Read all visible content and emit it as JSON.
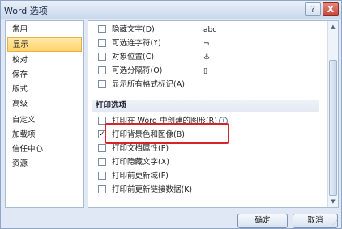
{
  "window": {
    "title": "Word 选项",
    "help": "?",
    "close": "X"
  },
  "sidebar": {
    "items": [
      {
        "label": "常用"
      },
      {
        "label": "显示"
      },
      {
        "label": "校对"
      },
      {
        "label": "保存"
      },
      {
        "label": "版式"
      },
      {
        "label": "高级"
      },
      {
        "label": "自定义"
      },
      {
        "label": "加载项"
      },
      {
        "label": "信任中心"
      },
      {
        "label": "资源"
      }
    ],
    "active": "显示"
  },
  "display_options": [
    {
      "label": "隐藏文字(D)",
      "checked": false,
      "symbol": "abc"
    },
    {
      "label": "可选连字符(Y)",
      "checked": false,
      "symbol": "¬"
    },
    {
      "label": "对象位置(C)",
      "checked": false,
      "symbol": "⚓"
    },
    {
      "label": "可选分隔符(O)",
      "checked": false,
      "symbol": "▯"
    },
    {
      "label": "显示所有格式标记(A)",
      "checked": false,
      "symbol": ""
    }
  ],
  "print_section_title": "打印选项",
  "print_options": [
    {
      "label": "打印在 Word 中创建的图形(R)",
      "checked": false,
      "info": "i"
    },
    {
      "label": "打印背景色和图像(B)",
      "checked": true
    },
    {
      "label": "打印文档属性(P)",
      "checked": false
    },
    {
      "label": "打印隐藏文字(X)",
      "checked": false
    },
    {
      "label": "打印前更新域(F)",
      "checked": false
    },
    {
      "label": "打印前更新链接数据(K)",
      "checked": false
    }
  ],
  "buttons": {
    "ok": "确定",
    "cancel": "取消"
  }
}
